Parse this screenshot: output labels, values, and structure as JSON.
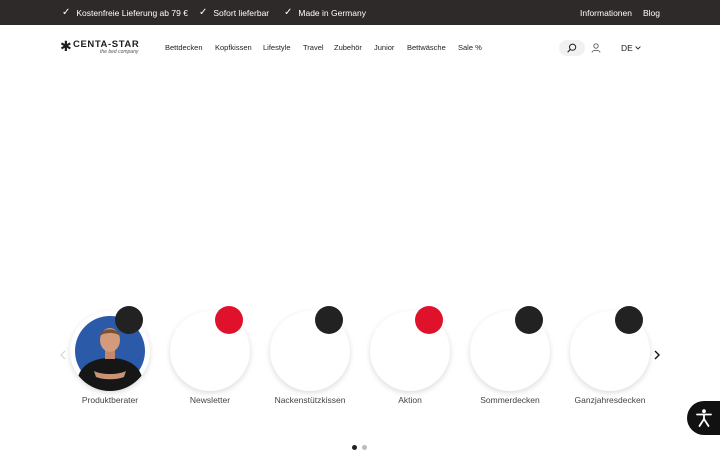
{
  "topbar": {
    "usps": [
      {
        "icon": "check-icon",
        "label": "Kostenfreie Lieferung ab 79 €"
      },
      {
        "icon": "check-icon",
        "label": "Sofort lieferbar"
      },
      {
        "icon": "check-icon",
        "label": "Made in Germany"
      }
    ],
    "links": [
      "Informationen",
      "Blog"
    ]
  },
  "header": {
    "logo": {
      "brand": "CENTA-STAR",
      "tagline": "the bed company"
    },
    "nav": [
      "Bettdecken",
      "Kopfkissen",
      "Lifestyle",
      "Travel",
      "Zubehör",
      "Junior",
      "Bettwäsche",
      "Sale %"
    ],
    "language": "DE"
  },
  "carousel": {
    "items": [
      {
        "label": "Produktberater",
        "badge_color": "#222222",
        "has_photo": true
      },
      {
        "label": "Newsletter",
        "badge_color": "#e0112b",
        "has_photo": false
      },
      {
        "label": "Nackenstützkissen",
        "badge_color": "#222222",
        "has_photo": false
      },
      {
        "label": "Aktion",
        "badge_color": "#e0112b",
        "has_photo": false
      },
      {
        "label": "Sommerdecken",
        "badge_color": "#222222",
        "has_photo": false
      },
      {
        "label": "Ganzjahresdecken",
        "badge_color": "#222222",
        "has_photo": false
      }
    ],
    "page_count": 2,
    "active_page": 1
  },
  "colors": {
    "topbar_bg": "#2d2a29",
    "accent_red": "#e0112b",
    "badge_dark": "#222222",
    "dot_active": "#222222",
    "dot_inactive": "#bbbbbb"
  }
}
